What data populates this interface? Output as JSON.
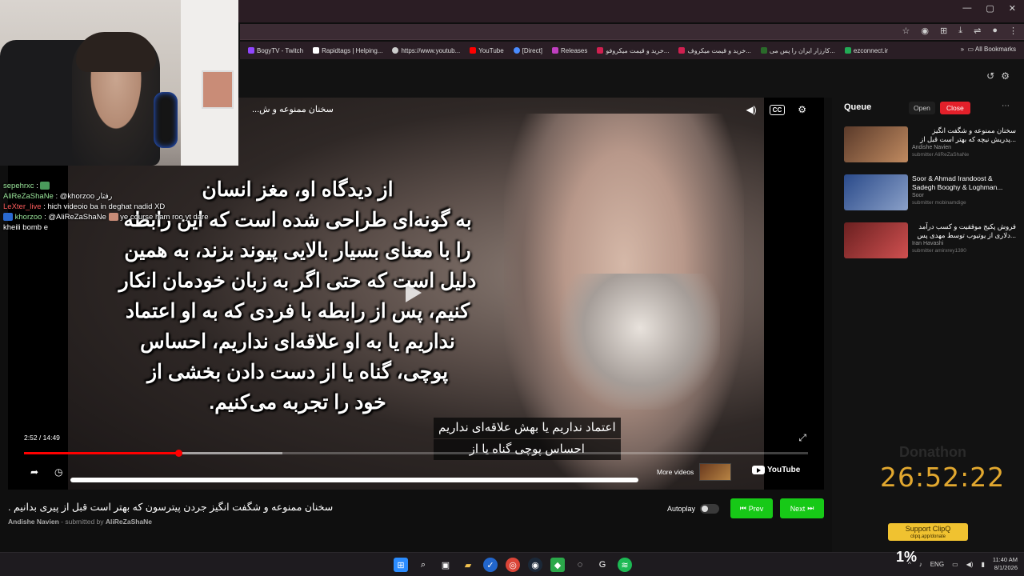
{
  "browser": {
    "window_controls": [
      "—",
      "▢",
      "✕"
    ],
    "bookmarks": [
      {
        "label": "BogyTV - Twitch",
        "color": "#9146ff"
      },
      {
        "label": "Rapidtags | Helping...",
        "color": "#ffffff"
      },
      {
        "label": "https://www.youtub...",
        "color": "#cccccc"
      },
      {
        "label": "YouTube",
        "color": "#ff0000"
      },
      {
        "label": "[Direct]",
        "color": "#4a8cff"
      },
      {
        "label": "Releases",
        "color": "#c03fc0"
      },
      {
        "label": "خرید و قیمت میکروفو...",
        "color": "#d02050"
      },
      {
        "label": "خرید و قیمت میکروف...",
        "color": "#d02050"
      },
      {
        "label": "کارزار ایران را پس می...",
        "color": "#2a6a2a"
      },
      {
        "label": "ezconnect.ir",
        "color": "#22aa55"
      }
    ],
    "all_bookmarks": "All Bookmarks"
  },
  "chat": [
    {
      "user": "sepehrxc",
      "sep": ":",
      "msg": "",
      "color": "u1"
    },
    {
      "user": "AliReZaShaNe",
      "sep": ":",
      "msg": "@khorzoo رفتار",
      "color": "u1"
    },
    {
      "user": "LeXter_live",
      "sep": ":",
      "msg": "hich videoio ba in deghat nadid XD",
      "color": "u3"
    },
    {
      "user": "khorzoo",
      "sep": ":",
      "msg": "@AliReZaShaNe",
      "msg2": "ye course ham roo yt dare",
      "color": "u4"
    },
    {
      "user": "",
      "sep": "",
      "msg": "kheili bomb e",
      "color": "u1"
    }
  ],
  "player": {
    "overlay_title": "سخنان ممنوعه و ش...",
    "big_caption": [
      "از دیدگاه او، مغز انسان",
      "به گونه‌ای طراحی شده است که این رابطه",
      "را با معنای بسیار بالایی پیوند بزند، به همین",
      "دلیل است که حتی اگر به زبان خودمان انکار",
      "کنیم، پس از رابطه با فردی که به او اعتماد",
      "نداریم یا به او علاقه‌ای نداریم، احساس",
      "پوچی، گناه یا از دست دادن بخشی از",
      "خود را تجربه می‌کنیم."
    ],
    "yt_captions": [
      "اعتماد نداریم یا بهش علاقه‌ای نداریم",
      "احساس پوچی گناه یا از"
    ],
    "time_current": "2:52",
    "time_total": "14:49",
    "time_display": "2:52 / 14:49",
    "progress_played": 0.197,
    "progress_buffered": 0.33,
    "more_videos": "More videos",
    "youtube": "YouTube"
  },
  "below": {
    "title": "سخنان ممنوعه و شگفت انگیز جردن پیترسون که بهتر است قبل از پیری بدانیم .",
    "channel": "Andishe Navien",
    "submitted_by_label": "- submitted by",
    "submitter": "AliReZaShaNe",
    "autoplay": "Autoplay",
    "prev": "Prev",
    "next": "Next"
  },
  "queue": {
    "heading": "Queue",
    "open": "Open",
    "close": "Close",
    "items": [
      {
        "title": "سخنان ممنوعه و شگفت انگیز ...پدریش نیچه که بهتر است قبل از",
        "channel": "Andishe Navien",
        "submitter": "submitter AliReZaShaNe",
        "color": "#5a3a2a"
      },
      {
        "title": "Soor & Ahmad Irandoost & Sadegh Booghy & Loghman...",
        "channel": "Soor",
        "submitter": "submitter mobinamdige",
        "color": "#2a4a8a"
      },
      {
        "title": "فروش پکیج موفقیت و کسب درآمد ...دلاری از یوتیوب توسط مهدی پس",
        "channel": "Iran Havashi",
        "submitter": "submitter amirxrey1390",
        "color": "#6a2020"
      }
    ]
  },
  "donathon": {
    "label": "Donathon",
    "timer": "26:52:22",
    "clipq": "Support ClipQ",
    "clipq_url": "clipq.app/donate"
  },
  "taskbar": {
    "percent": "1%",
    "lang": "ENG",
    "time": "11:40 AM",
    "date": "8/1/2026"
  }
}
